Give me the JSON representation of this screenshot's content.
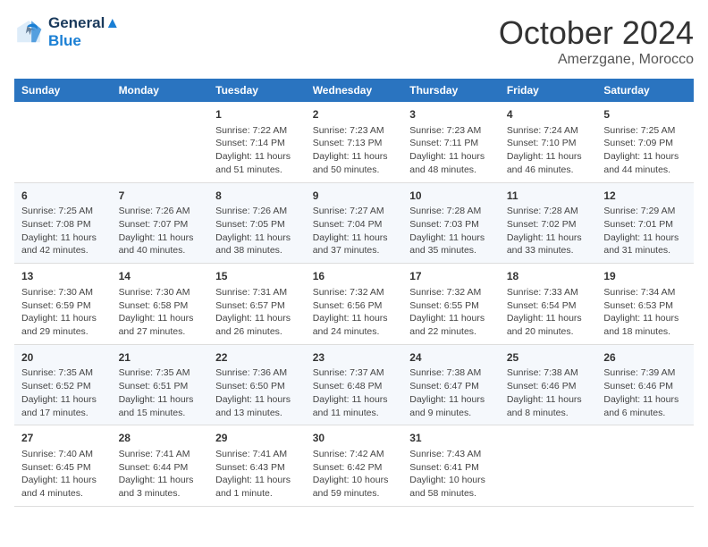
{
  "header": {
    "logo_line1": "General",
    "logo_line2": "Blue",
    "month_title": "October 2024",
    "location": "Amerzgane, Morocco"
  },
  "weekdays": [
    "Sunday",
    "Monday",
    "Tuesday",
    "Wednesday",
    "Thursday",
    "Friday",
    "Saturday"
  ],
  "weeks": [
    [
      {
        "day": "",
        "info": ""
      },
      {
        "day": "",
        "info": ""
      },
      {
        "day": "1",
        "info": "Sunrise: 7:22 AM\nSunset: 7:14 PM\nDaylight: 11 hours and 51 minutes."
      },
      {
        "day": "2",
        "info": "Sunrise: 7:23 AM\nSunset: 7:13 PM\nDaylight: 11 hours and 50 minutes."
      },
      {
        "day": "3",
        "info": "Sunrise: 7:23 AM\nSunset: 7:11 PM\nDaylight: 11 hours and 48 minutes."
      },
      {
        "day": "4",
        "info": "Sunrise: 7:24 AM\nSunset: 7:10 PM\nDaylight: 11 hours and 46 minutes."
      },
      {
        "day": "5",
        "info": "Sunrise: 7:25 AM\nSunset: 7:09 PM\nDaylight: 11 hours and 44 minutes."
      }
    ],
    [
      {
        "day": "6",
        "info": "Sunrise: 7:25 AM\nSunset: 7:08 PM\nDaylight: 11 hours and 42 minutes."
      },
      {
        "day": "7",
        "info": "Sunrise: 7:26 AM\nSunset: 7:07 PM\nDaylight: 11 hours and 40 minutes."
      },
      {
        "day": "8",
        "info": "Sunrise: 7:26 AM\nSunset: 7:05 PM\nDaylight: 11 hours and 38 minutes."
      },
      {
        "day": "9",
        "info": "Sunrise: 7:27 AM\nSunset: 7:04 PM\nDaylight: 11 hours and 37 minutes."
      },
      {
        "day": "10",
        "info": "Sunrise: 7:28 AM\nSunset: 7:03 PM\nDaylight: 11 hours and 35 minutes."
      },
      {
        "day": "11",
        "info": "Sunrise: 7:28 AM\nSunset: 7:02 PM\nDaylight: 11 hours and 33 minutes."
      },
      {
        "day": "12",
        "info": "Sunrise: 7:29 AM\nSunset: 7:01 PM\nDaylight: 11 hours and 31 minutes."
      }
    ],
    [
      {
        "day": "13",
        "info": "Sunrise: 7:30 AM\nSunset: 6:59 PM\nDaylight: 11 hours and 29 minutes."
      },
      {
        "day": "14",
        "info": "Sunrise: 7:30 AM\nSunset: 6:58 PM\nDaylight: 11 hours and 27 minutes."
      },
      {
        "day": "15",
        "info": "Sunrise: 7:31 AM\nSunset: 6:57 PM\nDaylight: 11 hours and 26 minutes."
      },
      {
        "day": "16",
        "info": "Sunrise: 7:32 AM\nSunset: 6:56 PM\nDaylight: 11 hours and 24 minutes."
      },
      {
        "day": "17",
        "info": "Sunrise: 7:32 AM\nSunset: 6:55 PM\nDaylight: 11 hours and 22 minutes."
      },
      {
        "day": "18",
        "info": "Sunrise: 7:33 AM\nSunset: 6:54 PM\nDaylight: 11 hours and 20 minutes."
      },
      {
        "day": "19",
        "info": "Sunrise: 7:34 AM\nSunset: 6:53 PM\nDaylight: 11 hours and 18 minutes."
      }
    ],
    [
      {
        "day": "20",
        "info": "Sunrise: 7:35 AM\nSunset: 6:52 PM\nDaylight: 11 hours and 17 minutes."
      },
      {
        "day": "21",
        "info": "Sunrise: 7:35 AM\nSunset: 6:51 PM\nDaylight: 11 hours and 15 minutes."
      },
      {
        "day": "22",
        "info": "Sunrise: 7:36 AM\nSunset: 6:50 PM\nDaylight: 11 hours and 13 minutes."
      },
      {
        "day": "23",
        "info": "Sunrise: 7:37 AM\nSunset: 6:48 PM\nDaylight: 11 hours and 11 minutes."
      },
      {
        "day": "24",
        "info": "Sunrise: 7:38 AM\nSunset: 6:47 PM\nDaylight: 11 hours and 9 minutes."
      },
      {
        "day": "25",
        "info": "Sunrise: 7:38 AM\nSunset: 6:46 PM\nDaylight: 11 hours and 8 minutes."
      },
      {
        "day": "26",
        "info": "Sunrise: 7:39 AM\nSunset: 6:46 PM\nDaylight: 11 hours and 6 minutes."
      }
    ],
    [
      {
        "day": "27",
        "info": "Sunrise: 7:40 AM\nSunset: 6:45 PM\nDaylight: 11 hours and 4 minutes."
      },
      {
        "day": "28",
        "info": "Sunrise: 7:41 AM\nSunset: 6:44 PM\nDaylight: 11 hours and 3 minutes."
      },
      {
        "day": "29",
        "info": "Sunrise: 7:41 AM\nSunset: 6:43 PM\nDaylight: 11 hours and 1 minute."
      },
      {
        "day": "30",
        "info": "Sunrise: 7:42 AM\nSunset: 6:42 PM\nDaylight: 10 hours and 59 minutes."
      },
      {
        "day": "31",
        "info": "Sunrise: 7:43 AM\nSunset: 6:41 PM\nDaylight: 10 hours and 58 minutes."
      },
      {
        "day": "",
        "info": ""
      },
      {
        "day": "",
        "info": ""
      }
    ]
  ]
}
